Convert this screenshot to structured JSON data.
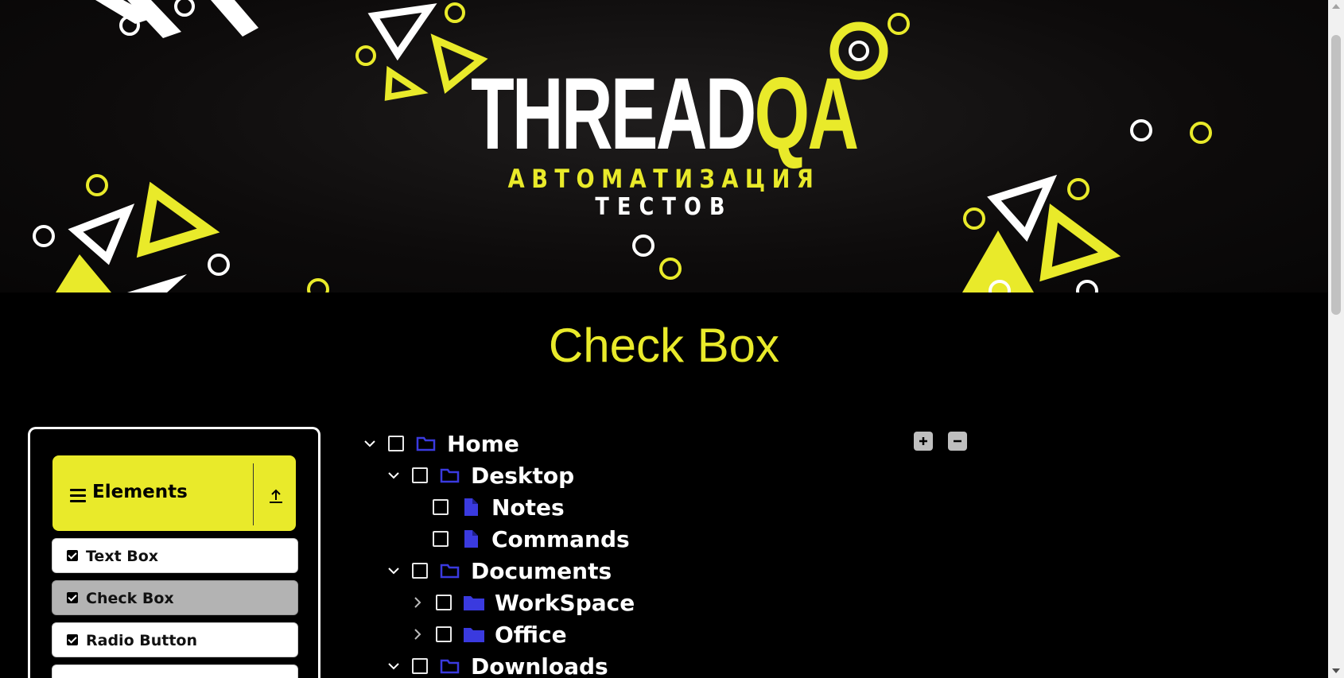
{
  "banner": {
    "logo_white": "THREAD",
    "logo_yellow": "QA",
    "subtitle_1": "АВТОМАТИЗАЦИЯ",
    "subtitle_2": "ТЕСТОВ"
  },
  "page": {
    "title": "Check Box"
  },
  "menu": {
    "group_title": "Elements",
    "items": [
      {
        "label": "Text Box",
        "active": false
      },
      {
        "label": "Check Box",
        "active": true
      },
      {
        "label": "Radio Button",
        "active": false
      }
    ]
  },
  "tree": {
    "expand_all_icon": "plus-square-icon",
    "collapse_all_icon": "minus-square-icon",
    "nodes": [
      {
        "label": "Home",
        "type": "folder-open",
        "expanded": true,
        "checked": false
      },
      {
        "label": "Desktop",
        "type": "folder-open",
        "expanded": true,
        "checked": false
      },
      {
        "label": "Notes",
        "type": "file",
        "checked": false
      },
      {
        "label": "Commands",
        "type": "file",
        "checked": false
      },
      {
        "label": "Documents",
        "type": "folder-open",
        "expanded": true,
        "checked": false
      },
      {
        "label": "WorkSpace",
        "type": "folder-closed",
        "expanded": false,
        "checked": false
      },
      {
        "label": "Office",
        "type": "folder-closed",
        "expanded": false,
        "checked": false
      },
      {
        "label": "Downloads",
        "type": "folder-open",
        "expanded": true,
        "checked": false
      }
    ]
  },
  "colors": {
    "accent": "#e9ea2a",
    "background": "#000000",
    "icon_blue": "#3a3adf"
  }
}
